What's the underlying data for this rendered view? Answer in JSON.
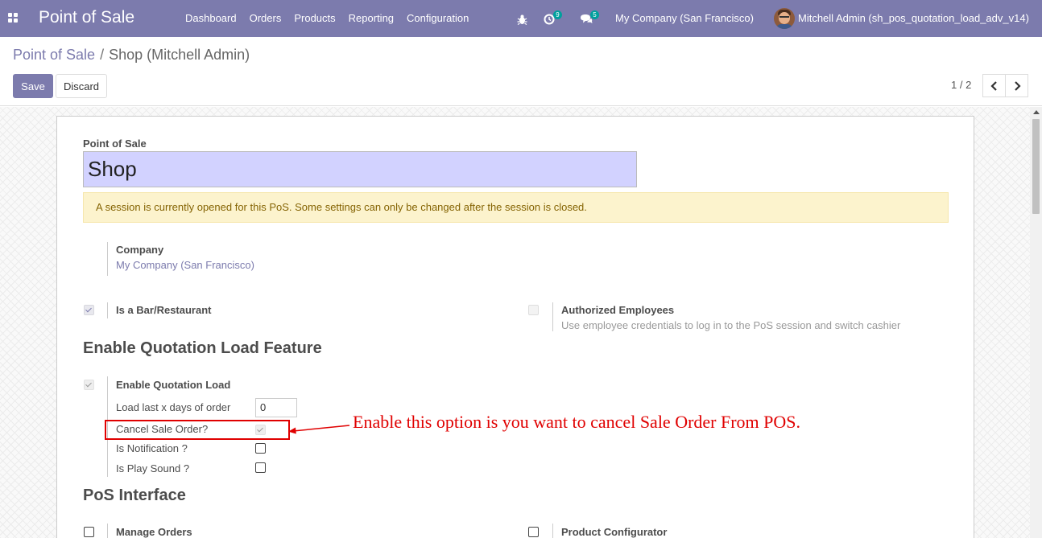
{
  "navbar": {
    "app_title": "Point of Sale",
    "menu": [
      "Dashboard",
      "Orders",
      "Products",
      "Reporting",
      "Configuration"
    ],
    "activity_count": "9",
    "message_count": "5",
    "company": "My Company (San Francisco)",
    "user": "Mitchell Admin (sh_pos_quotation_load_adv_v14)",
    "accent_color": "#7c7bad"
  },
  "breadcrumb": {
    "parent": "Point of Sale",
    "separator": "/",
    "current": "Shop (Mitchell Admin)"
  },
  "toolbar": {
    "save_label": "Save",
    "discard_label": "Discard",
    "pager": "1 / 2"
  },
  "form": {
    "name_label": "Point of Sale",
    "name_value": "Shop",
    "session_alert": "A session is currently opened for this PoS. Some settings can only be changed after the session is closed.",
    "company_label": "Company",
    "company_value": "My Company (San Francisco)",
    "bar_restaurant_label": "Is a Bar/Restaurant",
    "bar_restaurant_checked": true,
    "authorized_employees_label": "Authorized Employees",
    "authorized_employees_help": "Use employee credentials to log in to the PoS session and switch cashier",
    "authorized_employees_checked": false,
    "quotation_section_title": "Enable Quotation Load Feature",
    "enable_quotation_label": "Enable Quotation Load",
    "enable_quotation_checked": true,
    "load_days_label": "Load last x days of order",
    "load_days_value": "0",
    "cancel_sale_order_label": "Cancel Sale Order?",
    "cancel_sale_order_checked": true,
    "notification_label": "Is Notification ?",
    "notification_checked": false,
    "play_sound_label": "Is Play Sound ?",
    "play_sound_checked": false,
    "pos_interface_title": "PoS Interface",
    "manage_orders_label": "Manage Orders",
    "manage_orders_checked": false,
    "product_configurator_label": "Product Configurator",
    "product_configurator_checked": false
  },
  "annotation": {
    "text": "Enable this option is you want to cancel Sale Order From POS.",
    "color": "#e00000"
  }
}
